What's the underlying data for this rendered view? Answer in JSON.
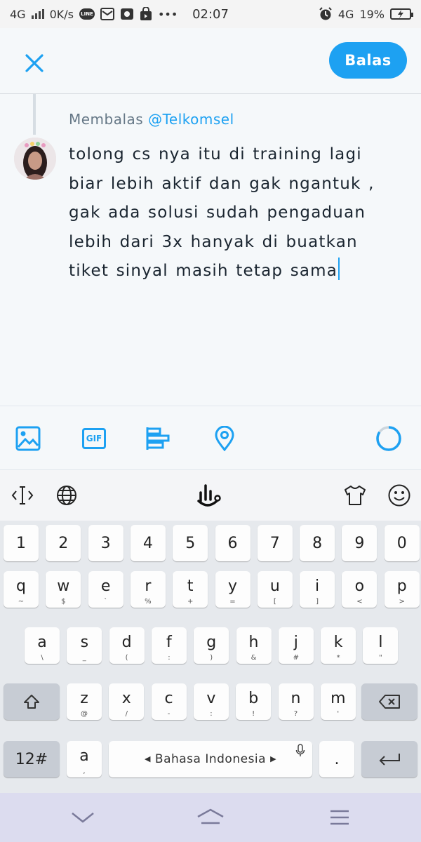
{
  "status_bar": {
    "network_left": "4G",
    "speed": "0K/s",
    "line_badge": "LINE",
    "time": "02:07",
    "network_right": "4G",
    "battery": "19%",
    "more": "•••"
  },
  "header": {
    "reply_label": "Balas"
  },
  "compose": {
    "reply_prefix": "Membalas ",
    "reply_handle": "@Telkomsel",
    "text": "tolong cs nya itu di training lagi biar lebih aktif dan gak ngantuk , gak ada solusi sudah pengaduan lebih dari 3x hanyak di buatkan tiket sinyal masih tetap sama"
  },
  "toolbar": {
    "gif_label": "GIF"
  },
  "keyboard": {
    "number_row": [
      "1",
      "2",
      "3",
      "4",
      "5",
      "6",
      "7",
      "8",
      "9",
      "0"
    ],
    "row1": [
      {
        "key": "q",
        "sub": "~"
      },
      {
        "key": "w",
        "sub": "$"
      },
      {
        "key": "e",
        "sub": "`"
      },
      {
        "key": "r",
        "sub": "%"
      },
      {
        "key": "t",
        "sub": "+"
      },
      {
        "key": "y",
        "sub": "="
      },
      {
        "key": "u",
        "sub": "["
      },
      {
        "key": "i",
        "sub": "]"
      },
      {
        "key": "o",
        "sub": "<"
      },
      {
        "key": "p",
        "sub": ">"
      }
    ],
    "row2": [
      {
        "key": "a",
        "sub": "\\"
      },
      {
        "key": "s",
        "sub": "_"
      },
      {
        "key": "d",
        "sub": "("
      },
      {
        "key": "f",
        "sub": ":"
      },
      {
        "key": "g",
        "sub": ")"
      },
      {
        "key": "h",
        "sub": "&"
      },
      {
        "key": "j",
        "sub": "#"
      },
      {
        "key": "k",
        "sub": "*"
      },
      {
        "key": "l",
        "sub": "\""
      }
    ],
    "row3": [
      {
        "key": "z",
        "sub": "@"
      },
      {
        "key": "x",
        "sub": "/"
      },
      {
        "key": "c",
        "sub": "-"
      },
      {
        "key": "v",
        "sub": ":"
      },
      {
        "key": "b",
        "sub": "!"
      },
      {
        "key": "n",
        "sub": "?"
      },
      {
        "key": "m",
        "sub": "'"
      }
    ],
    "symbols_label": "12#",
    "lang_key_main": "a",
    "lang_key_sub": ",",
    "space_label": "Bahasa Indonesia",
    "period_label": "."
  },
  "colors": {
    "accent": "#1da1f2",
    "background": "#f5f8fa",
    "keyboard_bg": "#e6e9ed",
    "navbar_bg": "#dcdcef"
  }
}
